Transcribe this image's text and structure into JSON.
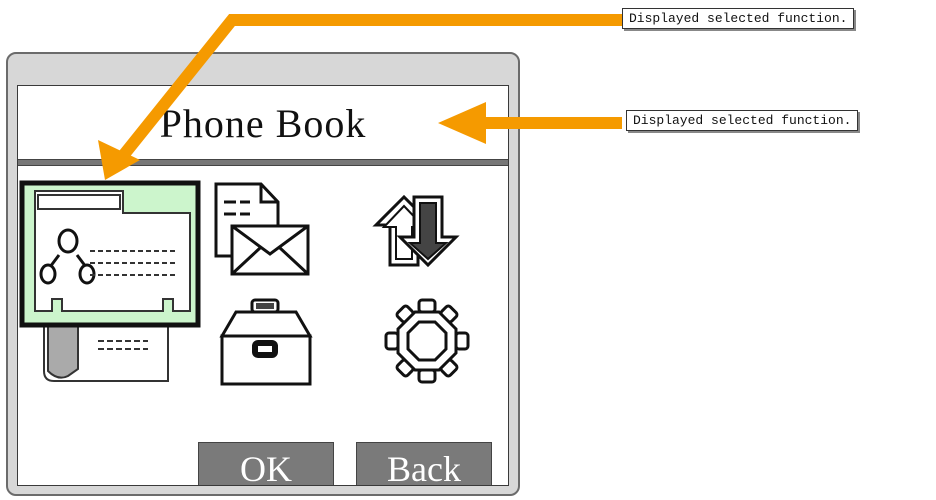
{
  "screen": {
    "title": "Phone Book",
    "icons": [
      {
        "name": "phonebook-icon",
        "state": "selected"
      },
      {
        "name": "message-icon",
        "state": "normal"
      },
      {
        "name": "transfer-arrows-icon",
        "state": "normal"
      },
      {
        "name": "toolbox-icon",
        "state": "normal"
      },
      {
        "name": "settings-gear-icon",
        "state": "normal"
      }
    ],
    "softkeys": {
      "ok": "OK",
      "back": "Back"
    }
  },
  "annotations": {
    "top_callout": "Displayed selected function.",
    "right_callout": "Displayed selected function."
  },
  "colors": {
    "arrow": "#f59a00",
    "selection_fill": "#ccf5cc",
    "softkey_bg": "#7a7a7a",
    "device_body": "#d7d7d7"
  }
}
